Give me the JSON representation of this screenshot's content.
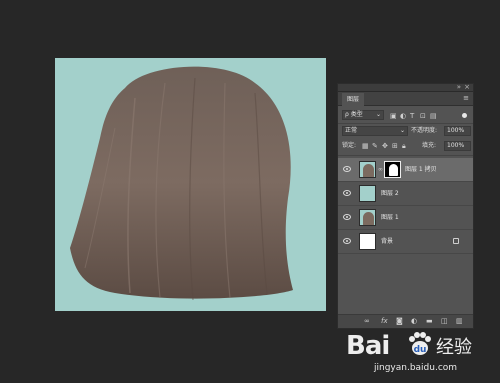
{
  "canvas": {
    "background_color": "#a3d0cb",
    "hair_color": "#7b6a5f"
  },
  "layers_panel": {
    "tab_label": "图层",
    "filter": {
      "label": "类型"
    },
    "blend_mode": "正常",
    "opacity": {
      "label": "不透明度:",
      "value": "100%"
    },
    "lock_label": "锁定:",
    "fill": {
      "label": "填充:",
      "value": "100%"
    },
    "layers": [
      {
        "name": "图层 1 拷贝",
        "thumbnail": "hair",
        "has_mask": true,
        "selected": true
      },
      {
        "name": "图层 2",
        "thumbnail": "teal",
        "has_mask": false,
        "selected": false
      },
      {
        "name": "图层 1",
        "thumbnail": "hair",
        "has_mask": false,
        "selected": false
      },
      {
        "name": "背景",
        "thumbnail": "white",
        "has_mask": false,
        "selected": false,
        "locked": true
      }
    ],
    "bottom_icons": [
      "link-icon",
      "fx-icon",
      "mask-icon",
      "adjustment-icon",
      "folder-icon",
      "new-layer-icon",
      "trash-icon"
    ]
  },
  "watermark": {
    "brand": "Bai",
    "brand_suffix": "经验",
    "url": "jingyan.baidu.com"
  }
}
